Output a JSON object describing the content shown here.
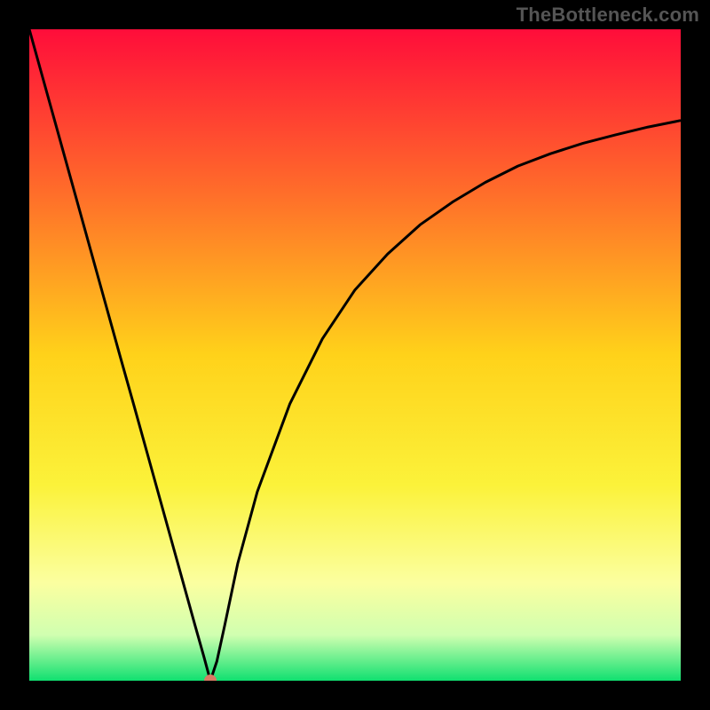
{
  "watermark": "TheBottleneck.com",
  "chart_data": {
    "type": "line",
    "title": "",
    "xlabel": "",
    "ylabel": "",
    "xlim": [
      0,
      100
    ],
    "ylim": [
      0,
      100
    ],
    "grid": false,
    "legend": false,
    "optimum_marker": {
      "x": 27.8,
      "y": 0
    },
    "gradient_stops": [
      {
        "pct": 0,
        "color": "#ff0d3a"
      },
      {
        "pct": 25,
        "color": "#ff6d2a"
      },
      {
        "pct": 50,
        "color": "#ffd21a"
      },
      {
        "pct": 70,
        "color": "#fbf23a"
      },
      {
        "pct": 85,
        "color": "#fbffa0"
      },
      {
        "pct": 93,
        "color": "#d0ffb0"
      },
      {
        "pct": 100,
        "color": "#10e070"
      }
    ],
    "stroke": {
      "color": "#000000",
      "width": 3
    },
    "series": [
      {
        "name": "bottleneck-curve",
        "x": [
          0,
          2,
          4,
          6,
          8,
          10,
          12,
          14,
          16,
          18,
          20,
          22,
          24,
          25.5,
          26.8,
          27.8,
          28.8,
          30,
          32,
          35,
          40,
          45,
          50,
          55,
          60,
          65,
          70,
          75,
          80,
          85,
          90,
          95,
          100
        ],
        "y": [
          100,
          92.8,
          85.6,
          78.4,
          71.2,
          64.0,
          56.8,
          49.6,
          42.5,
          35.3,
          28.1,
          20.9,
          13.7,
          8.3,
          3.7,
          0.0,
          3.0,
          8.5,
          18.0,
          29.0,
          42.5,
          52.5,
          60.0,
          65.5,
          70.0,
          73.5,
          76.5,
          79.0,
          80.9,
          82.5,
          83.8,
          85.0,
          86.0
        ]
      }
    ]
  }
}
